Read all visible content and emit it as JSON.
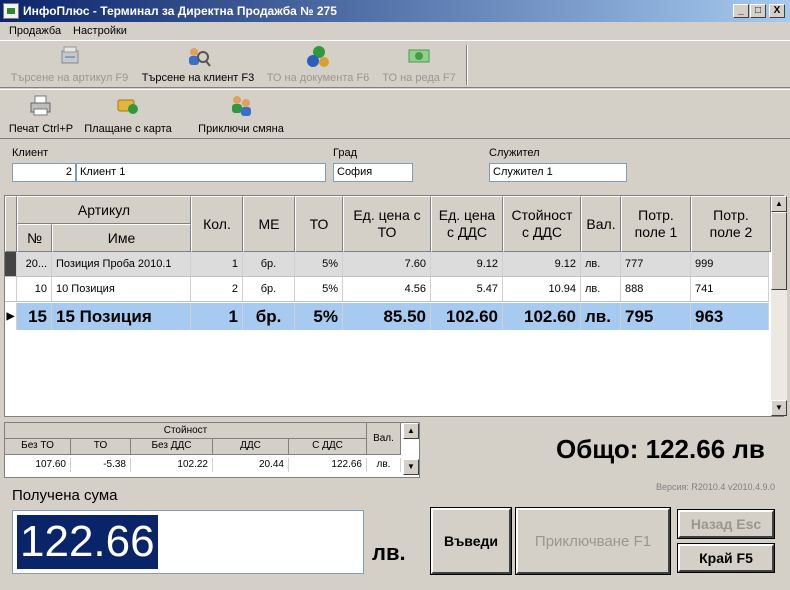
{
  "window": {
    "title": "ИнфоПлюс - Терминал за Директна Продажба № 275",
    "minimize": "_",
    "maximize": "□",
    "close": "X"
  },
  "menu": [
    "Продажба",
    "Настройки"
  ],
  "toolbar1": [
    {
      "label": "Търсене на артикул  F9",
      "icon": "scanner-icon",
      "enabled": false
    },
    {
      "label": "Търсене на клиент  F3",
      "icon": "client-search-icon",
      "enabled": true
    },
    {
      "label": "ТО на документа  F6",
      "icon": "currency-exchange-icon",
      "enabled": false
    },
    {
      "label": "ТО на реда  F7",
      "icon": "money-discount-icon",
      "enabled": false
    }
  ],
  "toolbar2": [
    {
      "label": "Печат  Ctrl+P",
      "icon": "printer-icon"
    },
    {
      "label": "Плащане с карта",
      "icon": "card-payment-icon"
    },
    {
      "label": "Приключи смяна",
      "icon": "users-icon"
    }
  ],
  "customer": {
    "client_label": "Клиент",
    "client_code": "2",
    "client_name": "Клиент 1",
    "city_label": "Град",
    "city": "София",
    "employee_label": "Служител",
    "employee": "Служител 1"
  },
  "grid": {
    "headers": {
      "article": "Артикул",
      "num": "№",
      "name": "Име",
      "qty": "Кол.",
      "unit": "МЕ",
      "discount": "ТО",
      "price": "Ед. цена с ТО",
      "price_vat": "Ед. цена с ДДС",
      "value_vat": "Стойност с ДДС",
      "currency": "Вал.",
      "field1": "Потр. поле 1",
      "field2": "Потр. поле 2"
    },
    "rows": [
      {
        "num": "20...",
        "name": "Позиция Проба 2010.1",
        "qty": "1",
        "unit": "бр.",
        "discount": "5%",
        "price": "7.60",
        "price_vat": "9.12",
        "value_vat": "9.12",
        "currency": "лв.",
        "field1": "777",
        "field2": "999"
      },
      {
        "num": "10",
        "name": "10 Позиция",
        "qty": "2",
        "unit": "бр.",
        "discount": "5%",
        "price": "4.56",
        "price_vat": "5.47",
        "value_vat": "10.94",
        "currency": "лв.",
        "field1": "888",
        "field2": "741"
      },
      {
        "num": "15",
        "name": "15 Позиция",
        "qty": "1",
        "unit": "бр.",
        "discount": "5%",
        "price": "85.50",
        "price_vat": "102.60",
        "value_vat": "102.60",
        "currency": "лв.",
        "field1": "795",
        "field2": "963"
      }
    ]
  },
  "totals": {
    "group_label": "Стойност",
    "currency_label": "Вал.",
    "headers": [
      "Без ТО",
      "ТО",
      "Без ДДС",
      "ДДС",
      "С ДДС"
    ],
    "values": [
      "107.60",
      "-5.38",
      "102.22",
      "20.44",
      "122.66"
    ],
    "currency": "лв."
  },
  "grand_total": "Общо: 122.66 лв",
  "version": "Версия:  R2010.4 v2010.4.9.0",
  "payment": {
    "label": "Получена сума",
    "amount": "122.66",
    "currency": "лв."
  },
  "buttons": {
    "enter": "Въведи",
    "finish": "Приключване  F1",
    "back": "Назад  Esc",
    "end": "Край  F5"
  },
  "colors": {
    "selected_row": "#a6caf0",
    "title_start": "#0a246a",
    "amount_bg": "#0a246a"
  }
}
